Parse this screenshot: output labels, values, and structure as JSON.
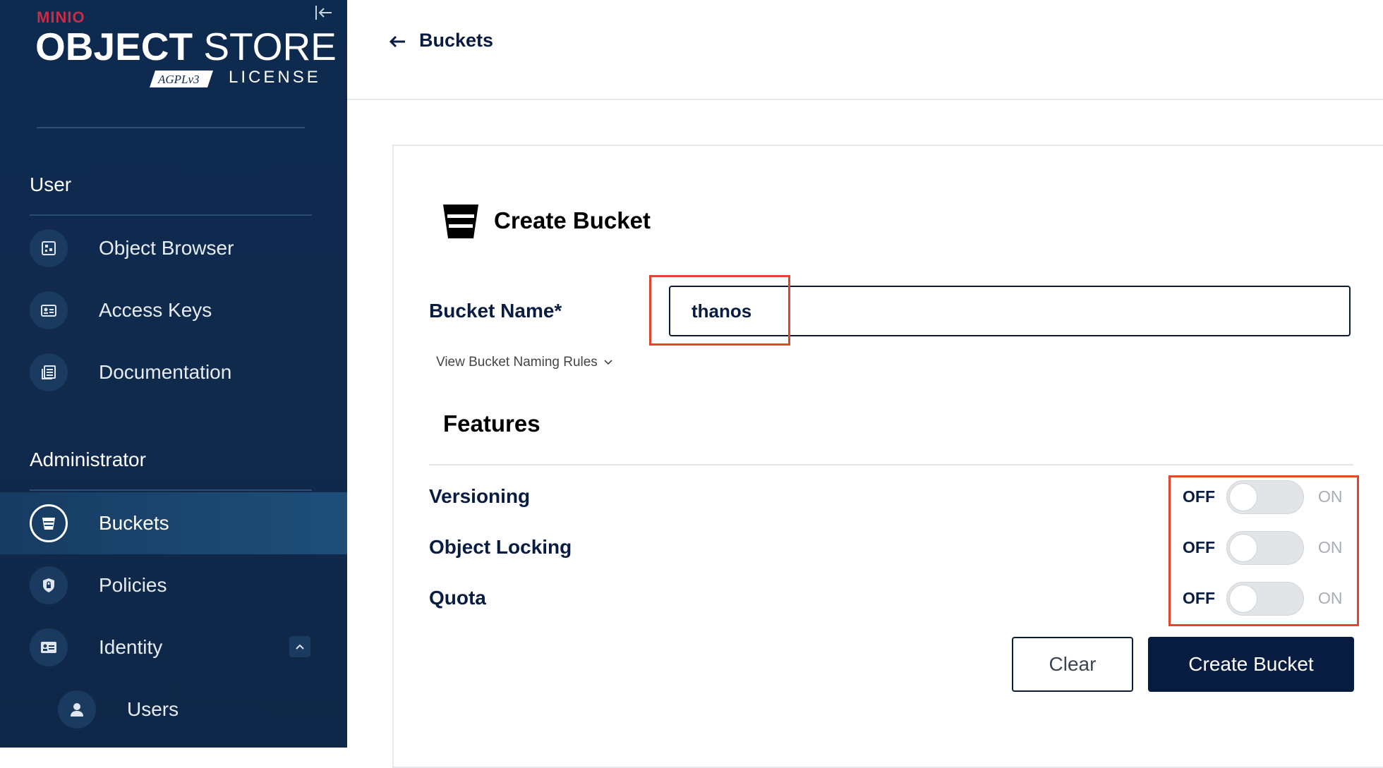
{
  "sidebar": {
    "brand": {
      "minio": "MINIO",
      "title_bold": "OBJECT",
      "title_rest": "STORE",
      "agpl": "AGPLv3",
      "license": "LICENSE"
    },
    "sections": [
      {
        "title": "User"
      },
      {
        "title": "Administrator"
      }
    ],
    "items": [
      {
        "label": "Object Browser",
        "icon": "object-browser-icon"
      },
      {
        "label": "Access Keys",
        "icon": "access-keys-icon"
      },
      {
        "label": "Documentation",
        "icon": "documentation-icon"
      },
      {
        "label": "Buckets",
        "icon": "bucket-icon",
        "active": true
      },
      {
        "label": "Policies",
        "icon": "policy-icon"
      },
      {
        "label": "Identity",
        "icon": "identity-icon",
        "expanded": true
      },
      {
        "label": "Users",
        "icon": "user-icon",
        "sub": true
      }
    ]
  },
  "header": {
    "breadcrumb": "Buckets"
  },
  "form": {
    "title": "Create Bucket",
    "bucket_name_label": "Bucket Name*",
    "bucket_name_value": "thanos",
    "naming_rules_link": "View Bucket Naming Rules",
    "features_title": "Features",
    "features": [
      {
        "label": "Versioning",
        "state": "OFF",
        "off_label": "OFF",
        "on_label": "ON"
      },
      {
        "label": "Object Locking",
        "state": "OFF",
        "off_label": "OFF",
        "on_label": "ON"
      },
      {
        "label": "Quota",
        "state": "OFF",
        "off_label": "OFF",
        "on_label": "ON"
      }
    ],
    "clear_label": "Clear",
    "create_label": "Create Bucket"
  },
  "colors": {
    "sidebar_bg": "#0f2748",
    "primary": "#081c42",
    "highlight": "#e2452c",
    "brand_red": "#c72c48"
  }
}
